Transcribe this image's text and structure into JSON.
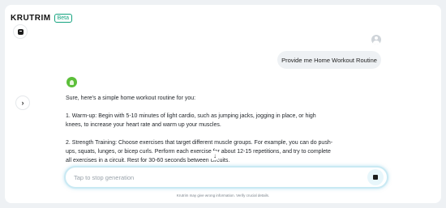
{
  "brand": {
    "name": "KRUTRIM",
    "badge": "Beta"
  },
  "icons": {
    "new_chat": "chat-bubble-icon",
    "user": "user-avatar-icon",
    "bot": "krutrim-leaf-icon",
    "expand_sidebar": "chevron-right-icon",
    "stop": "stop-square-icon",
    "scroll_down": "arrow-down-icon"
  },
  "conversation": {
    "user_message": "Provide me Home Workout Routine",
    "assistant_paragraphs": [
      "Sure, here's a simple home workout routine for you:",
      "1. Warm-up: Begin with 5-10 minutes of light cardio, such as jumping jacks, jogging in place, or high knees, to increase your heart rate and warm up your muscles.",
      "2. Strength Training: Choose exercises that target different muscle groups. For example, you can do push-ups, squats, lunges, or bicep curls. Perform each exercise for about 12-15 repetitions, and try to complete all exercises in a circuit. Rest for 30-60 seconds between circuits."
    ]
  },
  "composer": {
    "placeholder": "Tap to stop generation"
  },
  "footer": {
    "disclaimer": "Krutrim may give wrong information. Verify crucial details."
  },
  "colors": {
    "accent": "#14a37f",
    "bot_avatar": "#5cbf3a",
    "input_glow": "#c9e9f3",
    "background": "#eef1f4"
  }
}
